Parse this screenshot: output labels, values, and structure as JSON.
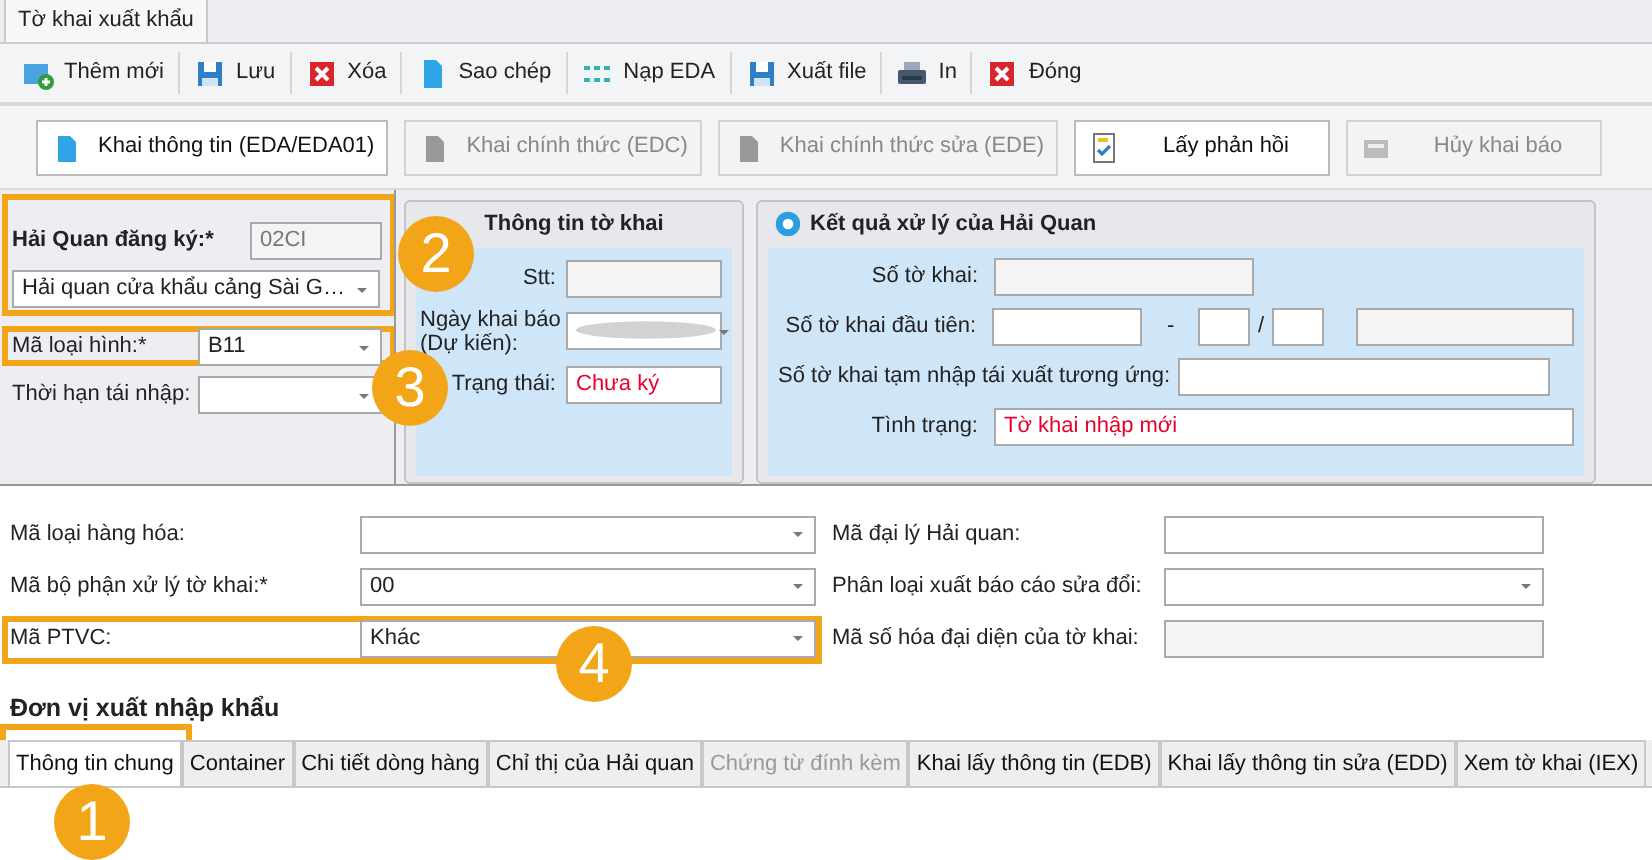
{
  "document_tab": {
    "label": "Tờ khai xuất khẩu",
    "selected": true
  },
  "toolbar": [
    {
      "label": "Thêm mới",
      "kind": "add"
    },
    {
      "label": "Lưu",
      "kind": "save"
    },
    {
      "label": "Xóa",
      "kind": "delete"
    },
    {
      "label": "Sao chép",
      "kind": "copy"
    },
    {
      "label": "Nạp EDA",
      "kind": "load"
    },
    {
      "label": "Xuất file",
      "kind": "save"
    },
    {
      "label": "In",
      "kind": "print"
    },
    {
      "label": "Đóng",
      "kind": "delete"
    }
  ],
  "actions": [
    {
      "label": "Khai thông tin (EDA/EDA01)",
      "disabled": false,
      "kind": "doc"
    },
    {
      "label": "Khai chính thức (EDC)",
      "disabled": true,
      "kind": "doc"
    },
    {
      "label": "Khai chính thức sửa (EDE)",
      "disabled": true,
      "kind": "doc"
    },
    {
      "label": "Lấy phản hồi",
      "disabled": false,
      "kind": "check"
    },
    {
      "label": "Hủy khai báo",
      "disabled": true,
      "kind": "cancel"
    }
  ],
  "registration": {
    "label": "Hải Quan đăng ký:*",
    "code": "02CI",
    "office": "Hải quan cửa khẩu cảng Sài G…"
  },
  "left_fields": [
    {
      "label": "Mã loại hình:*",
      "value": "B11",
      "kind": "select"
    },
    {
      "label": "Thời hạn tái nhập:",
      "kind": "select"
    }
  ],
  "declaration_info": {
    "title": "Thông tin tờ khai",
    "fields": [
      {
        "label": "Stt:",
        "kind": "readonly"
      },
      {
        "label": "Ngày khai báo (Dự kiến):",
        "kind": "blurred"
      },
      {
        "label": "Trạng thái:",
        "value": "Chưa ký",
        "kind": "status"
      }
    ]
  },
  "customs_result": {
    "title": "Kết quả xử lý của Hải Quan",
    "fields": [
      {
        "label": "Số tờ khai:",
        "kind": "readonly"
      },
      {
        "label": "Số tờ khai đầu tiên:",
        "kind": "split",
        "separators": [
          "-",
          "/"
        ]
      },
      {
        "label": "Số tờ khai tạm nhập tái xuất tương ứng:",
        "kind": "text"
      },
      {
        "label": "Tình trạng:",
        "value": "Tờ khai nhập mới",
        "kind": "status"
      }
    ]
  },
  "form_rows": [
    {
      "left": {
        "label": "Mã loại hàng hóa:",
        "kind": "select"
      },
      "right": {
        "label": "Mã đại lý Hải quan:",
        "kind": "text"
      }
    },
    {
      "left": {
        "label": "Mã bộ phận xử lý tờ khai:*",
        "value": "00",
        "kind": "select"
      },
      "right": {
        "label": "Phân loại xuất báo cáo sửa đổi:",
        "kind": "select"
      }
    },
    {
      "left": {
        "label": "Mã PTVC:",
        "value": "Khác",
        "kind": "select"
      },
      "right": {
        "label": "Mã số hóa đại diện của tờ khai:",
        "kind": "readonly"
      }
    }
  ],
  "section_title": "Đơn vị xuất nhập khẩu",
  "bottom_tabs": [
    {
      "label": "Thông tin chung",
      "selected": true,
      "disabled": false
    },
    {
      "label": "Container",
      "selected": false,
      "disabled": false
    },
    {
      "label": "Chi tiết dòng hàng",
      "selected": false,
      "disabled": false
    },
    {
      "label": "Chỉ thị của Hải quan",
      "selected": false,
      "disabled": false
    },
    {
      "label": "Chứng từ đính kèm",
      "selected": false,
      "disabled": true
    },
    {
      "label": "Khai lấy thông tin (EDB)",
      "selected": false,
      "disabled": false
    },
    {
      "label": "Khai lấy thông tin sửa (EDD)",
      "selected": false,
      "disabled": false
    },
    {
      "label": "Xem tờ khai (IEX)",
      "selected": false,
      "disabled": false
    }
  ],
  "callouts": [
    {
      "number": "2"
    },
    {
      "number": "3"
    },
    {
      "number": "4"
    },
    {
      "number": "1"
    }
  ]
}
